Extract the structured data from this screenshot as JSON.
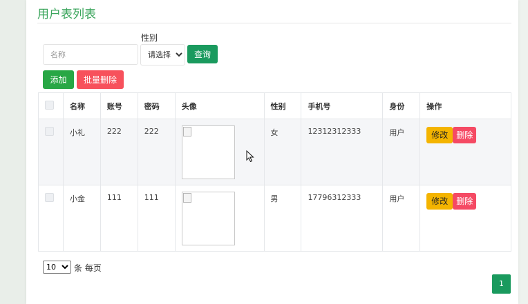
{
  "page": {
    "title": "用户表列表"
  },
  "search": {
    "name_placeholder": "名称",
    "gender_label": "性别",
    "gender_selected": "请选择",
    "query_label": "查询"
  },
  "actions": {
    "add_label": "添加",
    "batch_delete_label": "批量删除"
  },
  "table": {
    "headers": [
      "名称",
      "账号",
      "密码",
      "头像",
      "性别",
      "手机号",
      "身份",
      "操作"
    ],
    "rows": [
      {
        "name": "小礼",
        "account": "222",
        "password": "222",
        "gender": "女",
        "phone": "12312312333",
        "role": "用户"
      },
      {
        "name": "小金",
        "account": "111",
        "password": "111",
        "gender": "男",
        "phone": "17796312333",
        "role": "用户"
      }
    ],
    "edit_label": "修改",
    "delete_label": "删除"
  },
  "pagination": {
    "page_size": "10",
    "per_page_label": "条 每页",
    "current_page": "1"
  },
  "colors": {
    "title": "#3ba55c",
    "primary": "#1a9a5e",
    "add": "#28a745",
    "danger": "#f7515c",
    "warning": "#f4b400"
  }
}
